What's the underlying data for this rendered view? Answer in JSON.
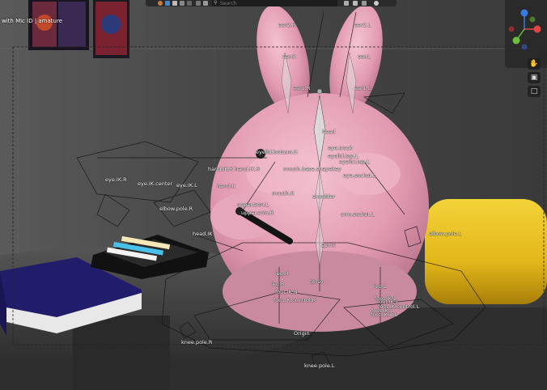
{
  "header": {
    "search_placeholder": "Search",
    "object_info": "with Mic ID | amature"
  },
  "colors": {
    "accent_x": "#e04646",
    "accent_y": "#6bbf3c",
    "accent_z": "#3a7be0",
    "bunny": "#e6a2b7",
    "cushion": "#e8c020"
  },
  "icons": {
    "search": "search-icon",
    "hand": "hand-pan-icon",
    "camera": "camera-icon",
    "lock": "lock-icon"
  },
  "bone_labels": [
    "ear2.R",
    "ear2.L",
    "ear.R",
    "ear.L",
    "ear1.R",
    "ear1.L",
    "head",
    "eye.track",
    "eyelid.bottom.R",
    "eyelid.top.L",
    "eyelid.top.L",
    "hand.IK.R",
    "hand.IK.R",
    "eye.IK.R",
    "eye.IK.center",
    "eye.IK.L",
    "mouth.base.shapekey",
    "eye.socket.L",
    "hand.R",
    "mouth.R",
    "shoulder",
    "elbow.pole.R",
    "upper.arm.L",
    "upper.arm.R",
    "arm.socket.L",
    "head.IK",
    "spine",
    "elbow.pole.L",
    "leg.R",
    "torso",
    "leg.L",
    "leg.R",
    "foot.IK.B",
    "foot.IK.control.R",
    "foot.IK.L",
    "foot.IK.control.L",
    "foot.IK.B.L",
    "foot.IK.L",
    "foot.IK.L",
    "Origin",
    "knee.pole.R",
    "knee.pole.L"
  ]
}
